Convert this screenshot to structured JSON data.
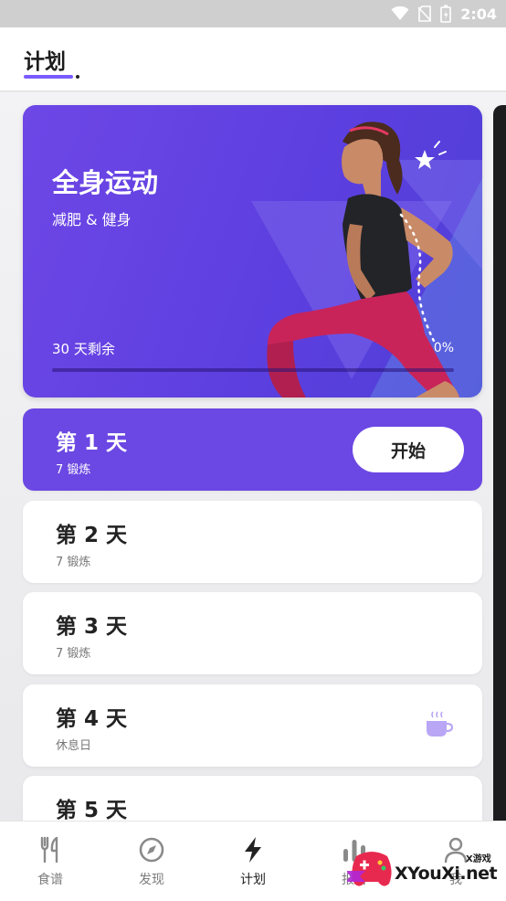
{
  "status_bar": {
    "time": "2:04",
    "icons": [
      "wifi-icon",
      "no-sim-icon",
      "battery-icon"
    ]
  },
  "header": {
    "title": "计划"
  },
  "plan_card": {
    "title": "全身运动",
    "subtitle": "减肥 & 健身",
    "days_remaining": "30 天剩余",
    "progress_text": "0%",
    "progress_fraction": 0
  },
  "days": [
    {
      "title": "第 1 天",
      "subtitle": "7 锻炼",
      "action_label": "开始",
      "active": true
    },
    {
      "title": "第 2 天",
      "subtitle": "7 锻炼"
    },
    {
      "title": "第 3 天",
      "subtitle": "7 锻炼"
    },
    {
      "title": "第 4 天",
      "subtitle": "休息日",
      "icon": "coffee-cup-icon"
    },
    {
      "title": "第 5 天",
      "subtitle": ""
    }
  ],
  "bottom_nav": [
    {
      "label": "食谱",
      "icon": "fork-knife-icon"
    },
    {
      "label": "发现",
      "icon": "compass-icon"
    },
    {
      "label": "计划",
      "icon": "lightning-icon",
      "active": true
    },
    {
      "label": "报告",
      "icon": "bar-chart-icon"
    },
    {
      "label": "我",
      "icon": "user-icon"
    }
  ],
  "watermark": {
    "text": "XYouXi.net",
    "small": "X游戏"
  },
  "colors": {
    "accent": "#6b47e3",
    "hero_start": "#6e47e6",
    "hero_end": "#4f3fd6",
    "icon_purple": "#b9a6f5"
  }
}
